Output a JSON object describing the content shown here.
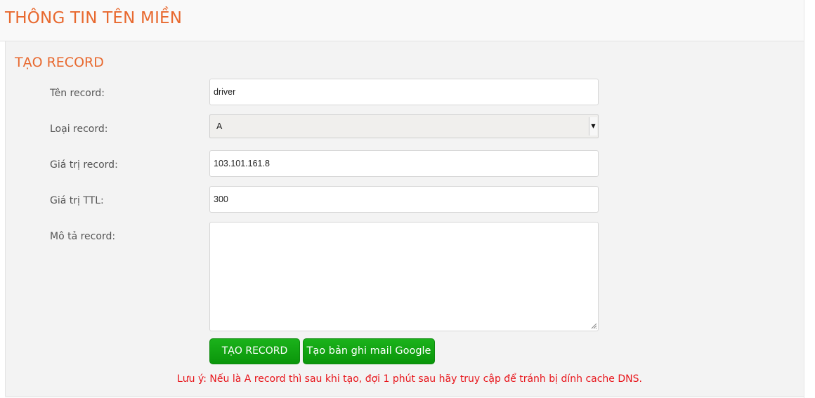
{
  "page": {
    "title": "THÔNG TIN TÊN MIỀN"
  },
  "panel": {
    "title": "TẠO RECORD"
  },
  "form": {
    "name_label": "Tên record:",
    "name_value": "driver",
    "type_label": "Loại record:",
    "type_selected": "A",
    "value_label": "Giá trị record:",
    "value_value": "103.101.161.8",
    "ttl_label": "Giá trị TTL:",
    "ttl_value": "300",
    "desc_label": "Mô tả record:",
    "desc_value": ""
  },
  "buttons": {
    "create_label": "TẠO RECORD",
    "google_label": "Tạo bản ghi mail Google"
  },
  "note": "Lưu ý: Nếu là A record thì sau khi tạo, đợi 1 phút sau hãy truy cập để tránh bị dính cache DNS.",
  "colors": {
    "title": "#e8692f",
    "button": "#0a960a",
    "note": "#e8151b"
  }
}
